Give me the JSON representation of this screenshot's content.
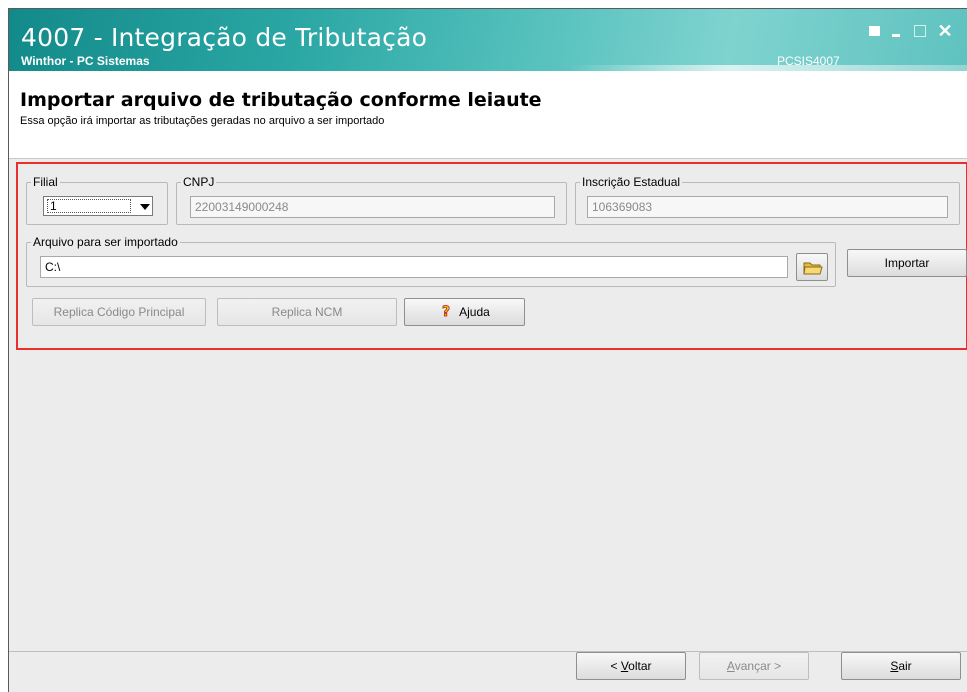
{
  "window": {
    "title": "4007 - Integração de Tributação",
    "subtitle": "Winthor - PC Sistemas",
    "routine_code": "PCSIS4007",
    "close_glyph": "✕"
  },
  "header": {
    "title": "Importar arquivo de tributação conforme leiaute",
    "description": "Essa opção irá importar as tributações geradas no arquivo a ser importado"
  },
  "form": {
    "filial": {
      "label": "Filial",
      "value": "1"
    },
    "cnpj": {
      "label": "CNPJ",
      "value": "22003149000248"
    },
    "inscricao": {
      "label": "Inscrição Estadual",
      "value": "106369083"
    },
    "arquivo": {
      "label": "Arquivo para ser importado",
      "value": "C:\\"
    },
    "importar_label": "Importar",
    "replica_codigo_label": "Replica Código Principal",
    "replica_ncm_label": "Replica NCM",
    "ajuda_label": "Ajuda"
  },
  "footer": {
    "voltar_prefix": "< ",
    "voltar_hotkey": "V",
    "voltar_rest": "oltar",
    "avancar_hotkey": "A",
    "avancar_rest": "vançar >",
    "sair_hotkey": "S",
    "sair_rest": "air"
  },
  "colors": {
    "title_bar": "#2aa7a4",
    "highlight_border": "#e8302c",
    "window_bg": "#ececec"
  }
}
